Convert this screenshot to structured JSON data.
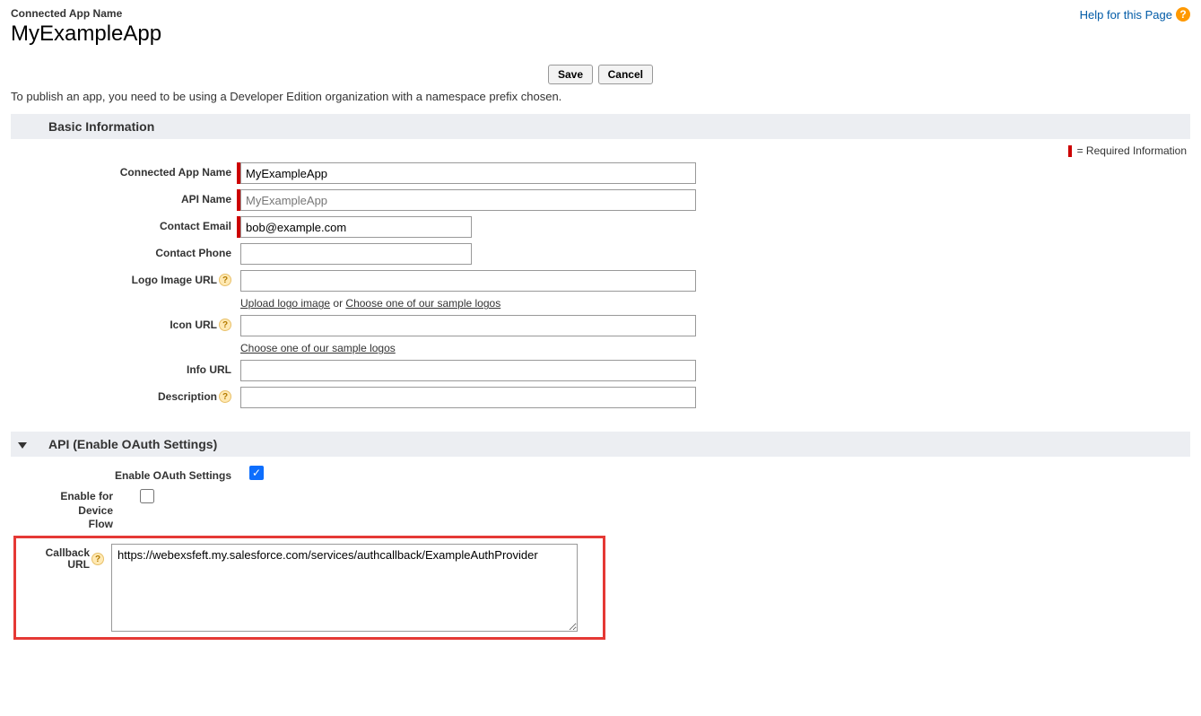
{
  "header": {
    "subtitle": "Connected App Name",
    "title": "MyExampleApp",
    "help_link": "Help for this Page"
  },
  "buttons": {
    "save": "Save",
    "cancel": "Cancel"
  },
  "publish_note": "To publish an app, you need to be using a Developer Edition organization with a namespace prefix chosen.",
  "sections": {
    "basic": "Basic Information",
    "api": "API (Enable OAuth Settings)"
  },
  "required_legend": "= Required Information",
  "labels": {
    "connected_app_name": "Connected App Name",
    "api_name": "API Name",
    "contact_email": "Contact Email",
    "contact_phone": "Contact Phone",
    "logo_image_url": "Logo Image URL",
    "icon_url": "Icon URL",
    "info_url": "Info URL",
    "description": "Description",
    "enable_oauth": "Enable OAuth Settings",
    "enable_device_flow_l1": "Enable for",
    "enable_device_flow_l2": "Device",
    "enable_device_flow_l3": "Flow",
    "callback_url_l1": "Callback",
    "callback_url_l2": "URL"
  },
  "values": {
    "connected_app_name": "MyExampleApp",
    "api_name": "MyExampleApp",
    "contact_email": "bob@example.com",
    "contact_phone": "",
    "logo_image_url": "",
    "icon_url": "",
    "info_url": "",
    "description": "",
    "callback_url": "https://webexsfeft.my.salesforce.com/services/authcallback/ExampleAuthProvider",
    "enable_oauth_checked": true,
    "enable_device_flow_checked": false
  },
  "hints": {
    "upload_logo": "Upload logo image",
    "or": " or ",
    "choose_sample": "Choose one of our sample logos",
    "choose_sample_icon": "Choose one of our sample logos"
  }
}
